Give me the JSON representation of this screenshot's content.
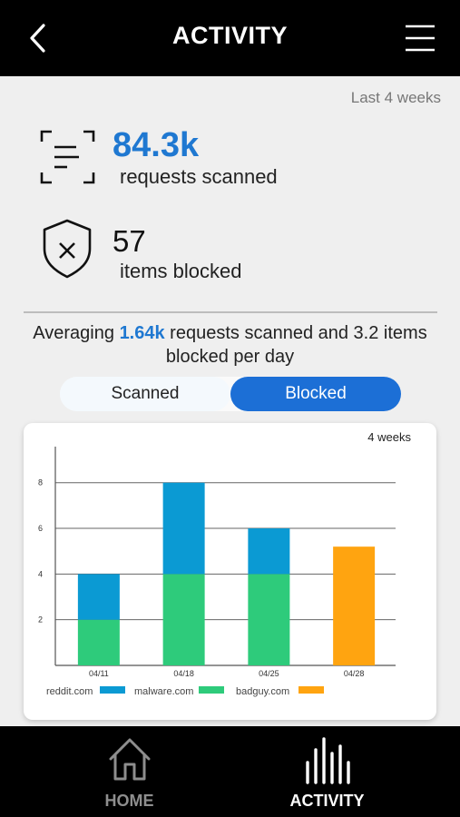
{
  "header": {
    "title": "ACTIVITY",
    "back_icon": "chevron-left-icon",
    "menu_icon": "hamburger-menu-icon"
  },
  "period": "Last 4 weeks",
  "stats": {
    "scanned": {
      "value": "84.3k",
      "label": "requests scanned",
      "icon": "scan-document-icon",
      "color": "#1f78d1"
    },
    "blocked": {
      "value": "57",
      "label": "items blocked",
      "icon": "shield-x-icon"
    }
  },
  "summary": {
    "prefix": "Averaging ",
    "highlight": "1.64k",
    "suffix": " requests scanned and 3.2 items blocked per day"
  },
  "toggle": {
    "scanned_label": "Scanned",
    "blocked_label": "Blocked",
    "selected": "Blocked"
  },
  "chart_data": {
    "type": "bar",
    "stacked": true,
    "range_label": "4 weeks",
    "categories": [
      "04/11",
      "04/18",
      "04/25",
      "04/28"
    ],
    "series": [
      {
        "name": "reddit.com",
        "color": "#0b9ad3",
        "values": [
          2,
          4,
          2,
          0
        ]
      },
      {
        "name": "malware.com",
        "color": "#2ecb7b",
        "values": [
          2,
          4,
          4,
          0
        ]
      },
      {
        "name": "badguy.com",
        "color": "#ffa410",
        "values": [
          0,
          0,
          0,
          5.2
        ]
      }
    ],
    "yticks": [
      2,
      4,
      6,
      8
    ],
    "ylim": [
      0,
      9.5
    ],
    "grid": true,
    "legend": "bottom"
  },
  "nav": {
    "items": [
      {
        "label": "HOME",
        "icon": "home-icon",
        "active": false
      },
      {
        "label": "ACTIVITY",
        "icon": "activity-bars-icon",
        "active": true
      }
    ]
  }
}
